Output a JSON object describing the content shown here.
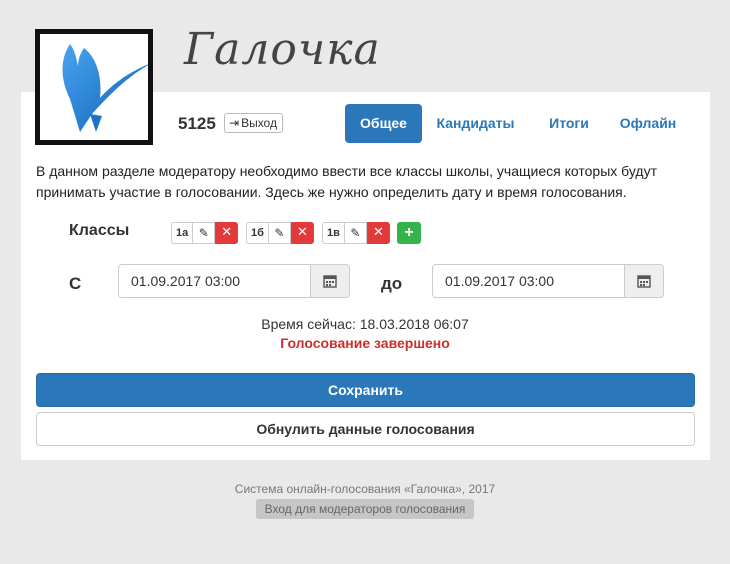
{
  "brand": {
    "title": "Галочка",
    "logo_icon": "bird-checkmark-logo-icon",
    "accent_color": "#1a73c8"
  },
  "user": {
    "id": "5125",
    "logout_label": "Выход",
    "logout_icon": "sign-out-icon"
  },
  "tabs": [
    {
      "label": "Общее",
      "active": true
    },
    {
      "label": "Кандидаты",
      "active": false
    },
    {
      "label": "Итоги",
      "active": false
    },
    {
      "label": "Офлайн",
      "active": false
    }
  ],
  "intro_text": "В данном разделе модератору необходимо ввести все классы школы, учащиеся которых будут принимать участие в голосовании. Здесь же нужно определить дату и время голосования.",
  "classes": {
    "label": "Классы",
    "items": [
      {
        "name": "1а"
      },
      {
        "name": "1б"
      },
      {
        "name": "1в"
      }
    ],
    "edit_icon": "pencil-icon",
    "delete_icon": "close-icon",
    "add_icon": "plus-icon"
  },
  "schedule": {
    "from_label": "С",
    "from_value": "01.09.2017 03:00",
    "to_label": "до",
    "to_value": "01.09.2017 03:00",
    "calendar_icon": "calendar-icon"
  },
  "now_text": "Время сейчас: 18.03.2018 06:07",
  "status_text": "Голосование завершено",
  "status_color": "#c9302c",
  "actions": {
    "save_label": "Сохранить",
    "reset_label": "Обнулить данные голосования"
  },
  "footer": {
    "copyright": "Система онлайн-голосования «Галочка», 2017",
    "moderator_link": "Вход для модераторов голосования"
  }
}
